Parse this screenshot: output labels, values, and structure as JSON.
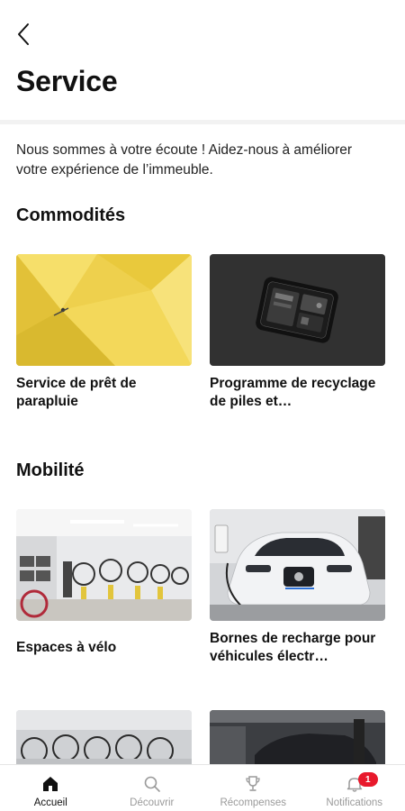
{
  "header": {
    "title": "Service"
  },
  "intro": {
    "text": "Nous sommes à votre écoute ! Aidez-nous à améliorer votre expérience de l’immeuble."
  },
  "sections": [
    {
      "title": "Commodités",
      "cards": [
        {
          "label": "Service de prêt de parapluie",
          "image": "yellow-umbrella-photo"
        },
        {
          "label": "Programme de recyclage de piles et…",
          "image": "phone-battery-photo"
        }
      ]
    },
    {
      "title": "Mobilité",
      "cards": [
        {
          "label": "Espaces à vélo",
          "image": "bike-room-photo"
        },
        {
          "label": "Bornes de recharge pour véhicules électr…",
          "image": "electric-car-charging-photo"
        }
      ]
    }
  ],
  "tabbar": {
    "items": [
      {
        "label": "Accueil",
        "icon": "home-icon",
        "active": true
      },
      {
        "label": "Découvrir",
        "icon": "search-icon",
        "active": false
      },
      {
        "label": "Récompenses",
        "icon": "trophy-icon",
        "active": false
      },
      {
        "label": "Notifications",
        "icon": "bell-icon",
        "active": false,
        "badge": "1"
      }
    ]
  },
  "colors": {
    "badge": "#e8192c",
    "text": "#111111",
    "tab_inactive": "#9a9a9a"
  }
}
